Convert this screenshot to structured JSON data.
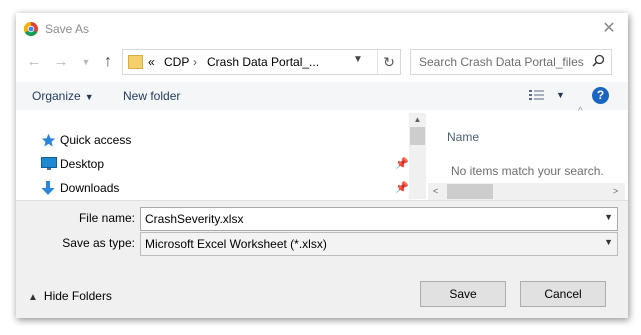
{
  "window": {
    "title": "Save As",
    "app_icon": "chrome-icon",
    "close_icon": "close-icon"
  },
  "address": {
    "back_icon": "arrow-left-icon",
    "forward_icon": "arrow-right-icon",
    "recent_icon": "chevron-down-icon",
    "up_icon": "arrow-up-icon",
    "overflow": "«",
    "crumbs": [
      "CDP",
      "Crash Data Portal_..."
    ],
    "separator": "›",
    "refresh_icon": "refresh-icon"
  },
  "search": {
    "placeholder": "Search Crash Data Portal_files",
    "icon": "search-icon"
  },
  "toolbar": {
    "organize_label": "Organize",
    "new_folder_label": "New folder",
    "view_icon": "view-options-icon",
    "help_label": "?"
  },
  "nav": {
    "items": [
      {
        "label": "Quick access",
        "icon": "star-icon",
        "pinned": false
      },
      {
        "label": "Desktop",
        "icon": "desktop-icon",
        "pinned": true
      },
      {
        "label": "Downloads",
        "icon": "download-icon",
        "pinned": true
      }
    ]
  },
  "list": {
    "column_name": "Name",
    "empty_message": "No items match your search."
  },
  "fields": {
    "file_name_label": "File name:",
    "file_name_value": "CrashSeverity.xlsx",
    "save_type_label": "Save as type:",
    "save_type_value": "Microsoft Excel Worksheet (*.xlsx)"
  },
  "footer": {
    "hide_folders_label": "Hide Folders",
    "save_label": "Save",
    "cancel_label": "Cancel"
  },
  "colors": {
    "accent": "#1a64c2",
    "link_text": "#1e395b",
    "panel_bg": "#f0f0f0"
  }
}
